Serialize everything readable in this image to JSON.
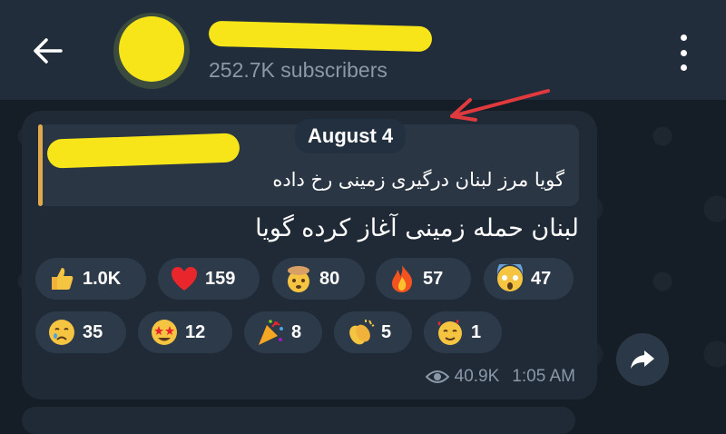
{
  "header": {
    "subscribers": "252.7K subscribers"
  },
  "message": {
    "date": "August 4",
    "reply_text": "گویا مرز لبنان درگیری زمینی رخ داده",
    "text": "لبنان حمله زمینی آغاز کرده گویا",
    "views": "40.9K",
    "time": "1:05 AM"
  },
  "reactions": [
    {
      "icon": "thumbs-up-icon",
      "count": "1.0K"
    },
    {
      "icon": "heart-icon",
      "count": "159"
    },
    {
      "icon": "exploding-head-icon",
      "count": "80"
    },
    {
      "icon": "fire-icon",
      "count": "57"
    },
    {
      "icon": "scream-icon",
      "count": "47"
    },
    {
      "icon": "crying-face-icon",
      "count": "35"
    },
    {
      "icon": "star-struck-icon",
      "count": "12"
    },
    {
      "icon": "party-popper-icon",
      "count": "8"
    },
    {
      "icon": "clapping-hands-icon",
      "count": "5"
    },
    {
      "icon": "smiling-hearts-icon",
      "count": "1"
    }
  ],
  "colors": {
    "background": "#151e27",
    "header": "#212d3b",
    "bubble": "#1f2a36",
    "reaction_pill": "#2d3a49",
    "redaction": "#f7e51a",
    "annotation_arrow": "#e0393e",
    "reply_accent": "#e0a94b"
  }
}
